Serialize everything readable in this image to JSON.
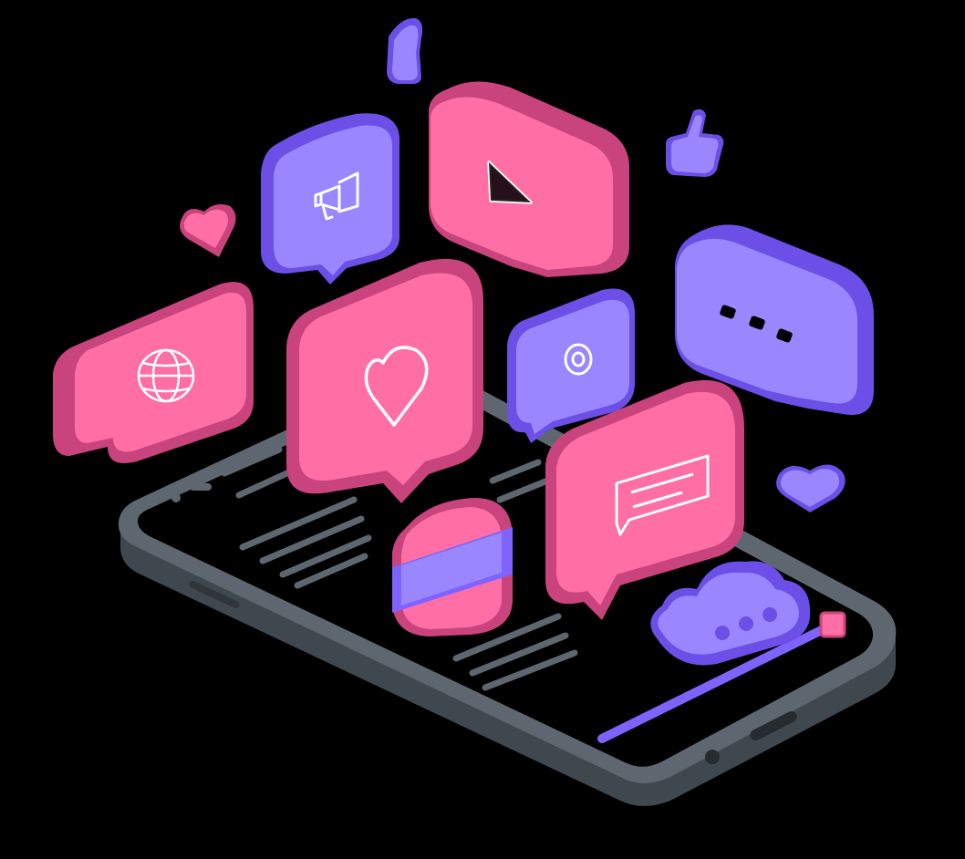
{
  "illustration": {
    "subject": "isometric-smartphone-with-social-media-chat-bubbles",
    "colors": {
      "background": "#000000",
      "phone_frame": "#5e6770",
      "phone_frame_dark": "#3f474f",
      "phone_screen": "#000000",
      "text_lines": "#5e6770",
      "pink_face": "#ff6fa6",
      "pink_side": "#c9437d",
      "pink_dark": "#b83a72",
      "purple_face": "#9a86ff",
      "purple_side": "#6b4fe6",
      "purple_bright": "#7f63ff",
      "icon_stroke": "#ffffff"
    },
    "bubbles": [
      {
        "name": "megaphone-bubble",
        "icon": "megaphone-icon",
        "color": "purple"
      },
      {
        "name": "play-bubble",
        "icon": "play-icon",
        "color": "pink"
      },
      {
        "name": "globe-bubble",
        "icon": "globe-icon",
        "color": "pink"
      },
      {
        "name": "heart-bubble",
        "icon": "heart-icon",
        "color": "pink"
      },
      {
        "name": "location-bubble",
        "icon": "location-icon",
        "color": "purple"
      },
      {
        "name": "typing-bubble",
        "icon": "ellipsis-icon",
        "color": "purple"
      },
      {
        "name": "message-bubble",
        "icon": "chat-lines-icon",
        "color": "pink"
      }
    ],
    "floating": [
      {
        "name": "thumbs-up-icon",
        "color": "purple"
      },
      {
        "name": "thumbs-up-small-icon",
        "color": "purple"
      },
      {
        "name": "floating-heart-pink-icon",
        "color": "pink"
      },
      {
        "name": "floating-heart-purple-icon",
        "color": "purple"
      },
      {
        "name": "cloud-icon",
        "color": "purple"
      },
      {
        "name": "credit-card-icon",
        "color": "pink"
      }
    ]
  }
}
